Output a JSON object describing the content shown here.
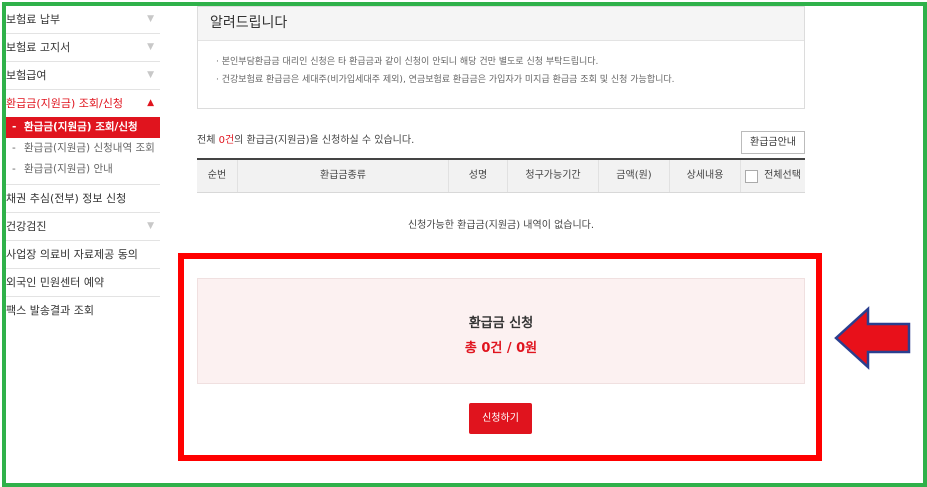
{
  "sidebar": {
    "items": [
      {
        "label": "보험료 납부"
      },
      {
        "label": "보험료 고지서"
      },
      {
        "label": "보험급여"
      },
      {
        "label": "환급금(지원금) 조회/신청"
      },
      {
        "label": "채권 추심(전부) 정보 신청"
      },
      {
        "label": "건강검진"
      },
      {
        "label": "사업장 의료비 자료제공 동의"
      },
      {
        "label": "외국인 민원센터 예약"
      },
      {
        "label": "팩스 발송결과 조회"
      }
    ],
    "subitems": [
      {
        "label": "환급금(지원금) 조회/신청"
      },
      {
        "label": "환급금(지원금) 신청내역 조회"
      },
      {
        "label": "환급금(지원금) 안내"
      }
    ]
  },
  "notice": {
    "title": "알려드립니다",
    "lines": [
      "본인부담환급금 대리인 신청은 타 환급금과 같이 신청이 안되니 해당 건만 별도로 신청 부탁드립니다.",
      "건강보험료 환급금은 세대주(비가입세대주 제외), 연금보험료 환급금은 가입자가 미지급 환급금 조회 및 신청 가능합니다."
    ]
  },
  "summary": {
    "prefix": "전체 ",
    "count": "0건",
    "suffix": "의 환급금(지원금)을 신청하실 수 있습니다."
  },
  "guide_button": "환급금안내",
  "table": {
    "headers": [
      "순번",
      "환급금종류",
      "성명",
      "청구가능기간",
      "금액(원)",
      "상세내용",
      "전체선택"
    ],
    "empty_message": "신청가능한 환급금(지원금) 내역이 없습니다."
  },
  "apply": {
    "title": "환급금 신청",
    "total": "총 0건 / 0원",
    "button": "신청하기"
  },
  "colors": {
    "accent": "#e0141e",
    "highlight_border": "#ff0000",
    "frame": "#2fb14a",
    "arrow_fill": "#e8101a",
    "arrow_stroke": "#2a3f8f"
  },
  "icons": {
    "chevron": "chevron-down-icon",
    "chevron_active": "chevron-up-icon",
    "annotation": "arrow-left-icon"
  }
}
